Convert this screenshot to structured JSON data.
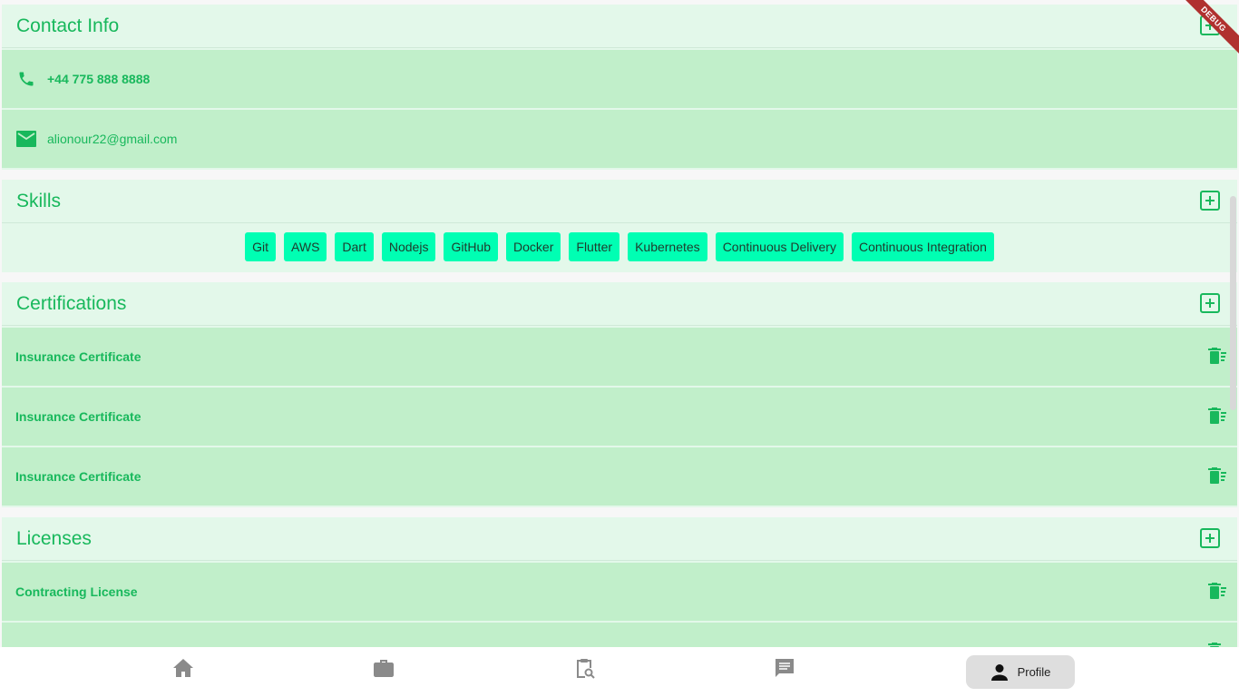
{
  "contact": {
    "title": "Contact Info",
    "phone": "+44 775 888 8888",
    "email": "alionour22@gmail.com"
  },
  "skills": {
    "title": "Skills",
    "items": [
      "Git",
      "AWS",
      "Dart",
      "Nodejs",
      "GitHub",
      "Docker",
      "Flutter",
      "Kubernetes",
      "Continuous Delivery",
      "Continuous Integration"
    ]
  },
  "certifications": {
    "title": "Certifications",
    "items": [
      "Insurance Certificate",
      "Insurance Certificate",
      "Insurance Certificate"
    ]
  },
  "licenses": {
    "title": "Licenses",
    "items": [
      "Contracting License"
    ]
  },
  "nav": {
    "profile_label": "Profile",
    "icons": [
      "home-icon",
      "briefcase-icon",
      "clipboard-search-icon",
      "chat-icon",
      "person-icon"
    ]
  },
  "debug_banner": "DEBUG",
  "colors": {
    "accent": "#18b85c",
    "card_bg": "#e3f8ea",
    "row_bg": "#c1efca",
    "chip_bg": "#00ffb3",
    "debug_banner": "#b0312f"
  }
}
